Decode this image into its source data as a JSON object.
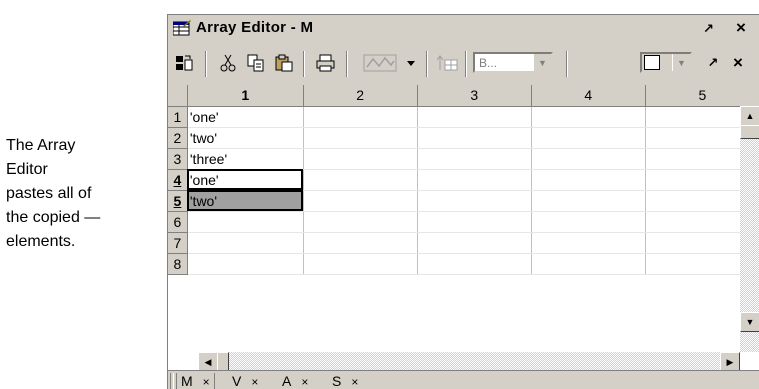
{
  "callout": {
    "text": "The Array\nEditor\npastes all of\nthe copied —\nelements."
  },
  "window": {
    "title": "Array Editor - M",
    "undock_glyph": "↗",
    "close_glyph": "×"
  },
  "toolbar": {
    "icons": [
      "import-data-icon",
      "cut-icon",
      "copy-icon",
      "paste-icon",
      "print-icon",
      "plot-icon",
      "plot-dropdown-icon",
      "sort-icon"
    ],
    "base_combo": "B...",
    "undock_glyph": "↗",
    "close_glyph": "×"
  },
  "grid": {
    "columns": [
      "1",
      "2",
      "3",
      "4",
      "5"
    ],
    "selected_column": "1",
    "rows": [
      {
        "label": "1",
        "value": "'one'"
      },
      {
        "label": "2",
        "value": "'two'"
      },
      {
        "label": "3",
        "value": "'three'"
      },
      {
        "label": "4",
        "value": "'one'",
        "selected": true
      },
      {
        "label": "5",
        "value": "'two'",
        "selected": true,
        "active": true
      },
      {
        "label": "6",
        "value": ""
      },
      {
        "label": "7",
        "value": ""
      },
      {
        "label": "8",
        "value": ""
      }
    ]
  },
  "tabs": [
    {
      "label": "M",
      "close": "×",
      "active": true
    },
    {
      "label": "V",
      "close": "×"
    },
    {
      "label": "A",
      "close": "×"
    },
    {
      "label": "S",
      "close": "×"
    }
  ]
}
